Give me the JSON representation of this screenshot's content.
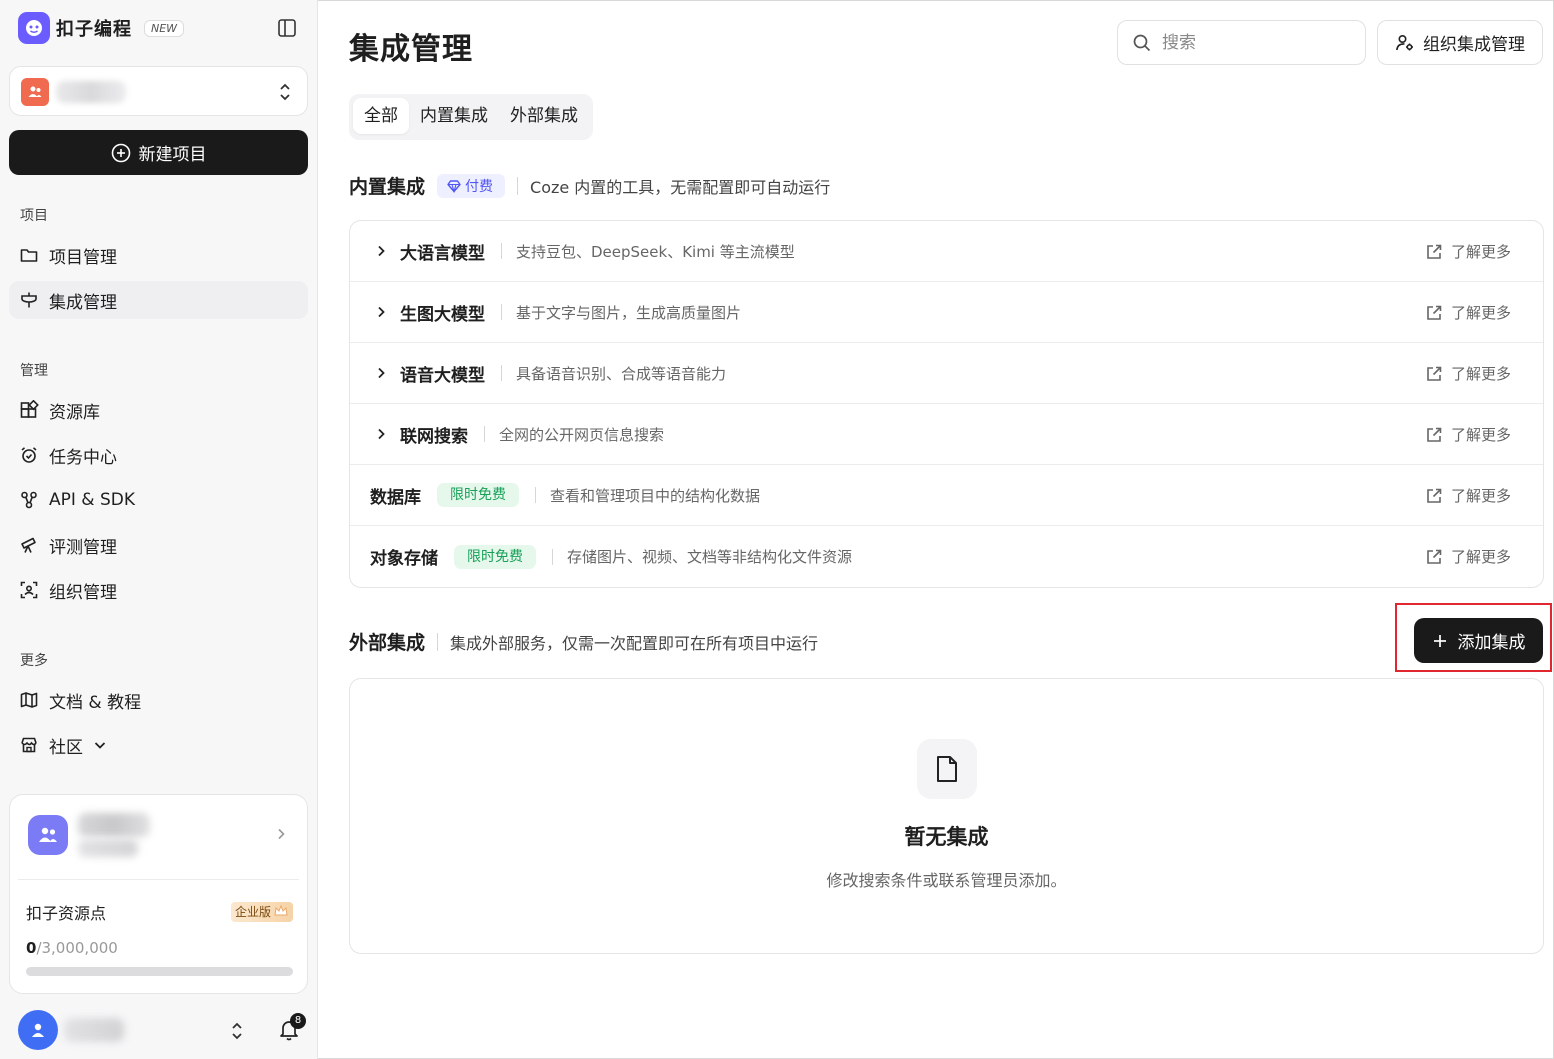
{
  "brand": {
    "name": "扣子编程",
    "badge": "NEW"
  },
  "sidebar": {
    "new_project": "新建项目",
    "sections": {
      "project": "项目",
      "manage": "管理",
      "more": "更多"
    },
    "project_items": [
      {
        "label": "项目管理",
        "icon": "folder-icon"
      },
      {
        "label": "集成管理",
        "icon": "plug-icon",
        "active": true
      }
    ],
    "manage_items": [
      {
        "label": "资源库",
        "icon": "blocks-icon"
      },
      {
        "label": "任务中心",
        "icon": "alarm-clock-icon"
      },
      {
        "label": "API & SDK",
        "icon": "api-icon"
      },
      {
        "label": "评测管理",
        "icon": "telescope-icon"
      },
      {
        "label": "组织管理",
        "icon": "org-scan-icon"
      }
    ],
    "more_items": [
      {
        "label": "文档 & 教程",
        "icon": "map-book-icon"
      },
      {
        "label": "社区",
        "icon": "store-icon"
      }
    ],
    "credits": {
      "title": "扣子资源点",
      "plan_badge": "企业版",
      "used": "0",
      "total": "/3,000,000",
      "progress": 0
    },
    "notifications_count": "8"
  },
  "header": {
    "title": "集成管理",
    "search_placeholder": "搜索",
    "org_button": "组织集成管理"
  },
  "tabs": [
    {
      "label": "全部",
      "active": true
    },
    {
      "label": "内置集成"
    },
    {
      "label": "外部集成"
    }
  ],
  "builtin": {
    "title": "内置集成",
    "badge": "付费",
    "description": "Coze 内置的工具，无需配置即可自动运行",
    "more_label": "了解更多",
    "rows": [
      {
        "name": "大语言模型",
        "desc": "支持豆包、DeepSeek、Kimi 等主流模型",
        "expandable": true
      },
      {
        "name": "生图大模型",
        "desc": "基于文字与图片，生成高质量图片",
        "expandable": true
      },
      {
        "name": "语音大模型",
        "desc": "具备语音识别、合成等语音能力",
        "expandable": true
      },
      {
        "name": "联网搜索",
        "desc": "全网的公开网页信息搜索",
        "expandable": true
      },
      {
        "name": "数据库",
        "badge": "限时免费",
        "desc": "查看和管理项目中的结构化数据",
        "expandable": false
      },
      {
        "name": "对象存储",
        "badge": "限时免费",
        "desc": "存储图片、视频、文档等非结构化文件资源",
        "expandable": false
      }
    ]
  },
  "external": {
    "title": "外部集成",
    "description": "集成外部服务，仅需一次配置即可在所有项目中运行",
    "add_button": "添加集成",
    "empty_title": "暂无集成",
    "empty_desc": "修改搜索条件或联系管理员添加。"
  },
  "colors": {
    "accent": "#1a1a1a",
    "paid": "#5256f5",
    "free": "#18a058",
    "highlight": "#e0262f"
  }
}
